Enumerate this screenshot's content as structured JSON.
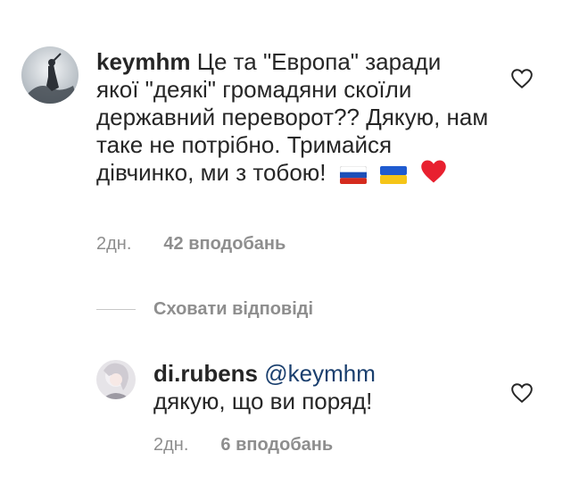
{
  "comments": [
    {
      "username": "keymhm",
      "text": "Це та \"Европа\" заради якої \"деякі\" громадяни скоїли державний переворот?? Дякую, нам таке не потрібно. Тримайся дівчинко, ми з тобою!",
      "emoji": [
        "russia-flag",
        "ukraine-flag",
        "red-heart"
      ],
      "time": "2дн.",
      "likes": "42 вподобань"
    }
  ],
  "replies_toggle": "Сховати відповіді",
  "reply": {
    "username": "di.rubens",
    "mention": "@keymhm",
    "text": "дякую, що ви поряд!",
    "time": "2дн.",
    "likes": "6 вподобань"
  },
  "colors": {
    "text": "#262626",
    "meta": "#8e8e8e",
    "mention": "#1a3f6e",
    "heart": "#e8202f"
  }
}
